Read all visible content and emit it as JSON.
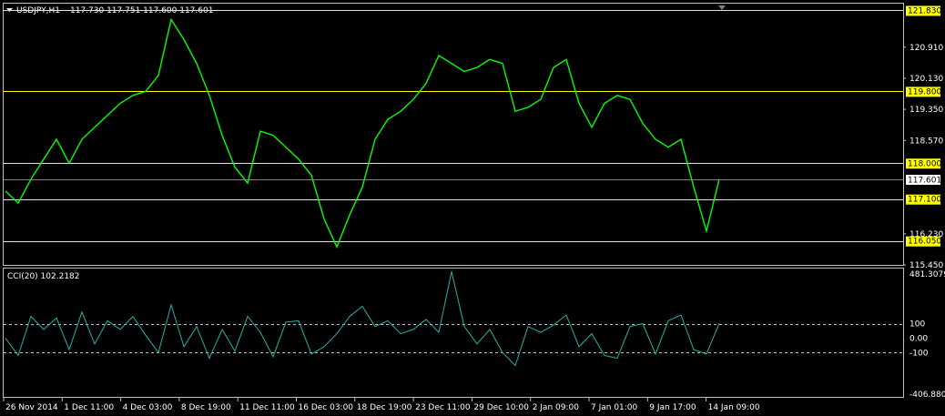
{
  "symbol_label": "USDJPY,H1",
  "ohlc_label": "117.730 117.751 117.600 117.601",
  "colors": {
    "background": "#000000",
    "price_line": "#00ff00",
    "cci_line": "#20b2aa",
    "level_line": "#ffff00",
    "frame": "#c0c0c0"
  },
  "chart_data": [
    {
      "type": "line",
      "title": "USDJPY,H1",
      "series": [
        {
          "name": "USDJPY,H1",
          "values": [
            117.3,
            117.0,
            117.6,
            118.1,
            118.6,
            118.0,
            118.6,
            118.9,
            119.2,
            119.5,
            119.7,
            119.8,
            120.2,
            121.6,
            121.1,
            120.5,
            119.7,
            118.7,
            117.9,
            117.5,
            118.8,
            118.7,
            118.4,
            118.1,
            117.7,
            116.6,
            115.9,
            116.7,
            117.4,
            118.6,
            119.1,
            119.3,
            119.6,
            120.0,
            120.7,
            120.5,
            120.3,
            120.4,
            120.6,
            120.5,
            119.3,
            119.4,
            119.6,
            120.4,
            120.6,
            119.5,
            118.9,
            119.5,
            119.7,
            119.6,
            119.0,
            118.6,
            118.4,
            118.6,
            117.4,
            116.3,
            117.6
          ]
        }
      ],
      "ylim": [
        115.45,
        122.0
      ],
      "y_ticks": [
        "120.910",
        "120.130",
        "119.350",
        "118.570",
        "116.230",
        "115.450"
      ],
      "x_ticks": [
        "26 Nov 2014",
        "1 Dec 11:00",
        "4 Dec 03:00",
        "8 Dec 19:00",
        "11 Dec 11:00",
        "16 Dec 03:00",
        "18 Dec 19:00",
        "23 Dec 11:00",
        "29 Dec 10:00",
        "2 Jan 09:00",
        "7 Jan 01:00",
        "9 Jan 17:00",
        "14 Jan 09:00"
      ],
      "levels": [
        121.83,
        119.8,
        118.0,
        117.1,
        116.05
      ],
      "level_labels": [
        "121.830",
        "119.800",
        "118.000",
        "117.100",
        "116.050"
      ],
      "current_price": 117.601,
      "current_label": "117.601"
    },
    {
      "type": "line",
      "title": "CCI(20) 102.2182",
      "series": [
        {
          "name": "CCI(20)",
          "values": [
            0,
            -120,
            150,
            60,
            140,
            -80,
            180,
            -40,
            120,
            60,
            150,
            20,
            -100,
            230,
            -60,
            80,
            -140,
            60,
            -90,
            150,
            40,
            -130,
            110,
            120,
            -110,
            -60,
            30,
            150,
            220,
            80,
            120,
            30,
            60,
            130,
            40,
            460,
            80,
            -40,
            60,
            -100,
            -190,
            80,
            40,
            90,
            160,
            -60,
            30,
            -120,
            -140,
            80,
            100,
            -110,
            120,
            160,
            -80,
            -110,
            102
          ]
        }
      ],
      "ylim": [
        -406.8805,
        481.3079
      ],
      "y_ticks": [
        "481.3079",
        "100",
        "0.00",
        "-100",
        "-406.8805"
      ],
      "levels": [
        100,
        -100
      ]
    }
  ]
}
